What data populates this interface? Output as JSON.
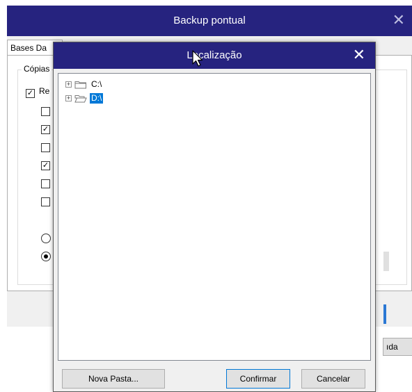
{
  "back_window": {
    "title": "Backup pontual",
    "close_glyph": "✕",
    "tab_label": "Bases Da",
    "group_label": "Cópias",
    "checkbox_label": "Re",
    "checkboxes": [
      {
        "checked": true
      },
      {
        "checked": false
      },
      {
        "checked": true
      },
      {
        "checked": false
      },
      {
        "checked": true
      },
      {
        "checked": false
      },
      {
        "checked": false
      }
    ],
    "radios": [
      {
        "selected": false
      },
      {
        "selected": true
      }
    ],
    "button_label": "ıda"
  },
  "dialog": {
    "title": "Localização",
    "close_glyph": "✕",
    "tree": [
      {
        "label": "C:\\",
        "expander": "+",
        "selected": false
      },
      {
        "label": "D:\\",
        "expander": "+",
        "selected": true
      }
    ],
    "buttons": {
      "new_folder": "Nova Pasta...",
      "confirm": "Confirmar",
      "cancel": "Cancelar"
    }
  },
  "colors": {
    "titlebar": "#26237f",
    "selection": "#0078d7",
    "window_bg": "#f0f0f0"
  },
  "icons": {
    "folder": "folder-icon",
    "close": "close-icon",
    "cursor": "mouse-cursor-icon"
  }
}
